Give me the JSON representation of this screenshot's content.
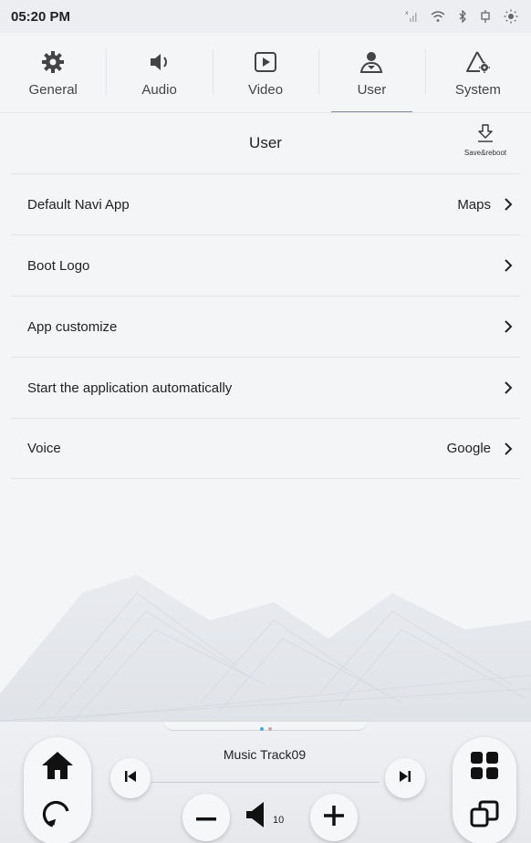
{
  "status_bar": {
    "time": "05:20 PM",
    "icons": [
      "no-signal-icon",
      "wifi-icon",
      "bluetooth-icon",
      "usb-icon",
      "brightness-icon"
    ]
  },
  "tabs": [
    {
      "label": "General",
      "icon": "gear-icon",
      "active": false
    },
    {
      "label": "Audio",
      "icon": "speaker-icon",
      "active": false
    },
    {
      "label": "Video",
      "icon": "play-icon",
      "active": false
    },
    {
      "label": "User",
      "icon": "user-icon",
      "active": true
    },
    {
      "label": "System",
      "icon": "system-icon",
      "active": false
    }
  ],
  "header": {
    "title": "User",
    "save_label": "Save&reboot"
  },
  "settings": [
    {
      "label": "Default Navi App",
      "value": "Maps"
    },
    {
      "label": "Boot Logo",
      "value": ""
    },
    {
      "label": "App customize",
      "value": ""
    },
    {
      "label": "Start the application automatically",
      "value": ""
    },
    {
      "label": "Voice",
      "value": "Google"
    }
  ],
  "player": {
    "track": "Music  Track09",
    "volume": "10"
  },
  "colors": {
    "accent_dot": "#4aa8e0",
    "inactive_dot": "#c9a7a7",
    "active_tab_underline": "#7f8c9a"
  }
}
